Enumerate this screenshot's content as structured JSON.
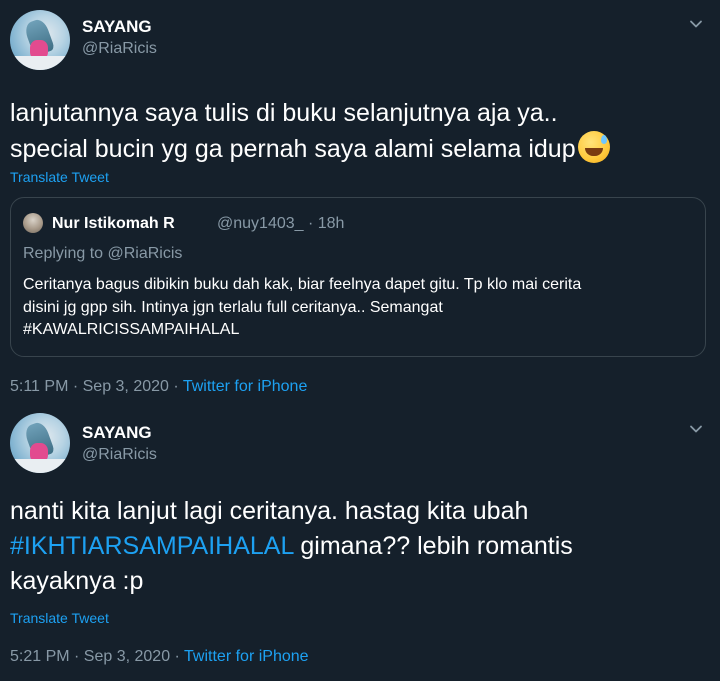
{
  "tweets": [
    {
      "name": "SAYANG",
      "handle": "@RiaRicis",
      "text_line1": "lanjutannya saya tulis di buku selanjutnya aja ya..",
      "text_line2": "special bucin yg ga pernah saya alami selama idup",
      "emoji": "sweat-smile-emoji",
      "translate_label": "Translate Tweet",
      "quote": {
        "name": "Nur Istikomah R",
        "handle_time": "@nuy1403_ · 18h",
        "reply_prefix": "Replying to ",
        "reply_handle": "@RiaRicis",
        "text_line1": "Ceritanya bagus dibikin buku dah kak, biar feelnya dapet gitu. Tp klo mai cerita",
        "text_line2": "disini jg gpp sih. Intinya jgn terlalu full ceritanya.. Semangat",
        "text_line3": "#KAWALRICISSAMPAIHALAL"
      },
      "timestamp": "5:11 PM · Sep 3, 2020 · ",
      "source": "Twitter for iPhone"
    },
    {
      "name": "SAYANG",
      "handle": "@RiaRicis",
      "text_line1": "nanti kita lanjut lagi ceritanya. hastag kita ubah",
      "hashtag": "#IKHTIARSAMPAIHALAL",
      "text_line2_rest": " gimana?? lebih romantis",
      "text_line3": "kayaknya :p",
      "translate_label": "Translate Tweet",
      "timestamp": "5:21 PM · Sep 3, 2020 · ",
      "source": "Twitter for iPhone"
    }
  ],
  "colors": {
    "background": "#15202b",
    "text": "#ffffff",
    "muted": "#8899a6",
    "accent": "#1da1f2",
    "border": "#38444d"
  }
}
